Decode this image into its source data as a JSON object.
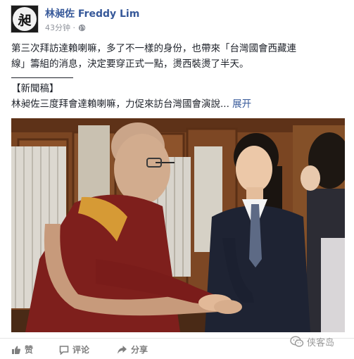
{
  "post": {
    "author": "林昶佐 Freddy Lim",
    "avatar_glyph": "昶",
    "time": "43分钟 ·",
    "privacy_icon": "globe-icon",
    "body_line1": "第三次拜訪達賴喇嘛，多了不一樣的身份，也帶來「台灣國會西藏連",
    "body_line2": "線」籌組的消息，決定要穿正式一點，燙西裝燙了半天。",
    "press_tag": "【新聞稿】",
    "press_text": "林昶佐三度拜會達賴喇嘛，力促來訪台灣國會演說...",
    "expand_label": "展开"
  },
  "actions": {
    "like": {
      "label": "赞",
      "icon": "thumbs-up-icon"
    },
    "comment": {
      "label": "评论",
      "icon": "comment-icon"
    },
    "share": {
      "label": "分享",
      "icon": "share-icon"
    }
  },
  "watermark": {
    "label": "侠客岛",
    "icon": "wechat-icon"
  },
  "colors": {
    "link": "#365899",
    "text": "#1d2129",
    "meta": "#90949c",
    "action": "#7f7f7f"
  }
}
